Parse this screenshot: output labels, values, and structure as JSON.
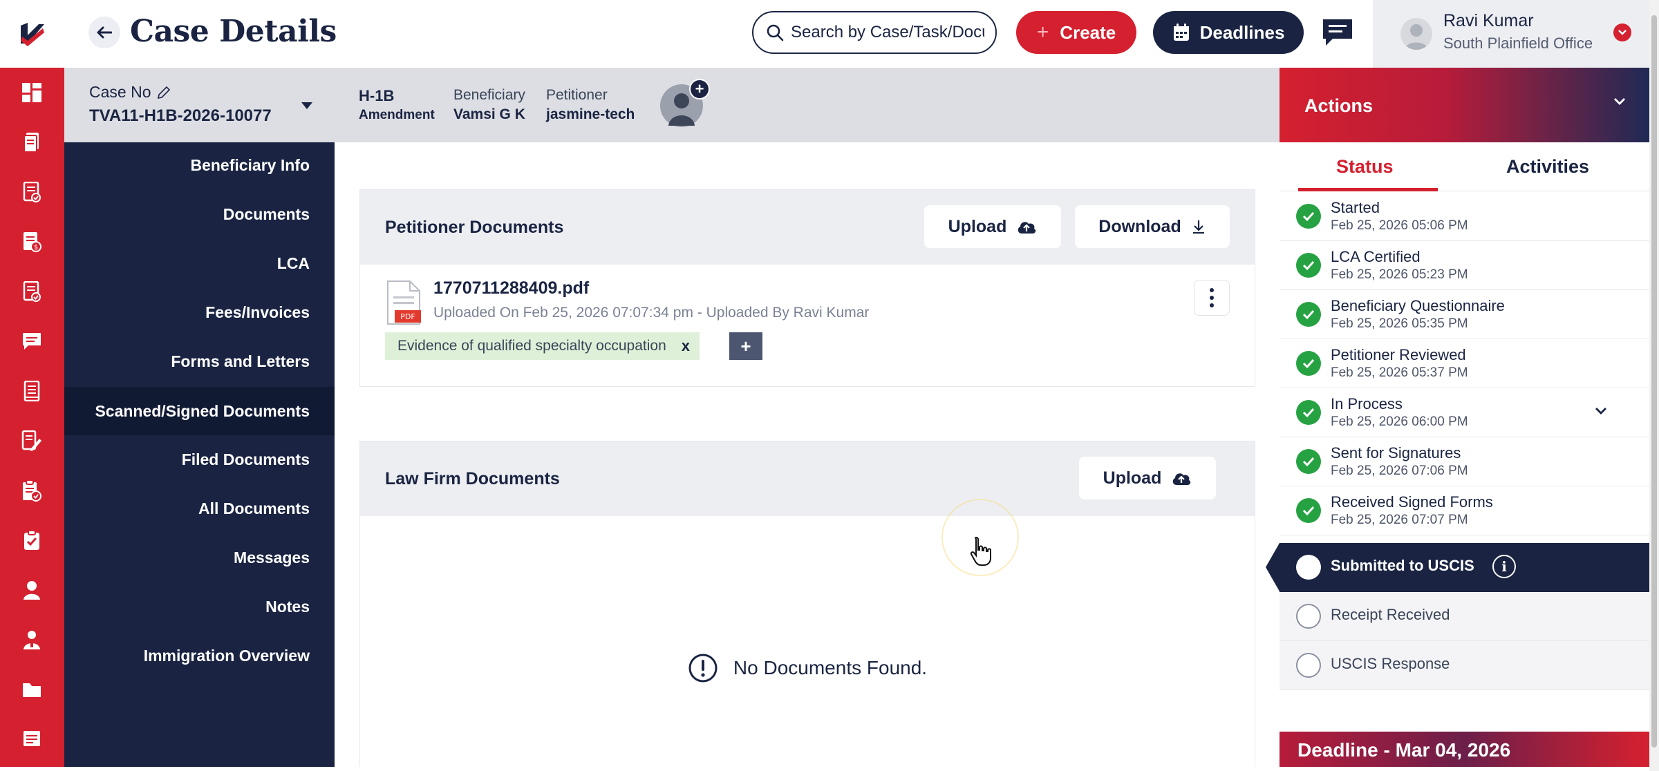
{
  "header": {
    "title": "Case Details",
    "search_placeholder": "Search by Case/Task/Document",
    "create_label": "Create",
    "deadlines_label": "Deadlines",
    "user": {
      "name": "Ravi Kumar",
      "office": "South Plainfield Office"
    }
  },
  "rail": {
    "icons": [
      "dashboard-icon",
      "cases-icon",
      "tasks-icon",
      "invoices-icon",
      "forms-icon",
      "chat-icon",
      "book-icon",
      "edit-list-icon",
      "clipboard-icon",
      "checklist-icon",
      "user-icon",
      "users-icon",
      "folder-icon",
      "notes-icon"
    ]
  },
  "case": {
    "case_no_label": "Case No",
    "case_no": "TVA11-H1B-2026-10077",
    "visa_type": "H-1B",
    "visa_subtype": "Amendment",
    "beneficiary_label": "Beneficiary",
    "beneficiary": "Vamsi G K",
    "petitioner_label": "Petitioner",
    "petitioner": "jasmine-tech"
  },
  "section_nav": [
    {
      "label": "Beneficiary Info",
      "active": false
    },
    {
      "label": "Documents",
      "active": false
    },
    {
      "label": "LCA",
      "active": false
    },
    {
      "label": "Fees/Invoices",
      "active": false
    },
    {
      "label": "Forms and Letters",
      "active": false
    },
    {
      "label": "Scanned/Signed Documents",
      "active": true
    },
    {
      "label": "Filed Documents",
      "active": false
    },
    {
      "label": "All Documents",
      "active": false
    },
    {
      "label": "Messages",
      "active": false
    },
    {
      "label": "Notes",
      "active": false
    },
    {
      "label": "Immigration Overview",
      "active": false
    }
  ],
  "petitioner_docs": {
    "title": "Petitioner Documents",
    "upload_label": "Upload",
    "download_label": "Download",
    "file": {
      "name": "1770711288409.pdf",
      "badge": "PDF",
      "meta": "Uploaded On Feb 25, 2026 07:07:34 pm - Uploaded By Ravi Kumar",
      "tag": "Evidence of qualified specialty occupation",
      "tag_remove": "x",
      "tag_add": "+"
    }
  },
  "law_firm_docs": {
    "title": "Law Firm Documents",
    "upload_label": "Upload",
    "empty_text": "No Documents Found."
  },
  "actions": {
    "title": "Actions",
    "tabs": {
      "status": "Status",
      "activities": "Activities",
      "active": "Status"
    },
    "steps": [
      {
        "title": "Started",
        "date": "Feb 25, 2026 05:06 PM",
        "state": "done"
      },
      {
        "title": "LCA Certified",
        "date": "Feb 25, 2026 05:23 PM",
        "state": "done"
      },
      {
        "title": "Beneficiary Questionnaire",
        "date": "Feb 25, 2026 05:35 PM",
        "state": "done"
      },
      {
        "title": "Petitioner Reviewed",
        "date": "Feb 25, 2026 05:37 PM",
        "state": "done"
      },
      {
        "title": "In Process",
        "date": "Feb 25, 2026 06:00 PM",
        "state": "done"
      },
      {
        "title": "Sent for Signatures",
        "date": "Feb 25, 2026 07:06 PM",
        "state": "done"
      },
      {
        "title": "Received Signed Forms",
        "date": "Feb 25, 2026 07:07 PM",
        "state": "done"
      },
      {
        "title": "Submitted to USCIS",
        "date": "",
        "state": "current"
      },
      {
        "title": "Receipt Received",
        "date": "",
        "state": "pending"
      },
      {
        "title": "USCIS Response",
        "date": "",
        "state": "pending"
      }
    ],
    "deadline": "Deadline - Mar 04, 2026"
  },
  "colors": {
    "brand_red": "#d5202f",
    "navy": "#1a2442",
    "success_green": "#27a243",
    "tag_green": "#dff0d8"
  }
}
